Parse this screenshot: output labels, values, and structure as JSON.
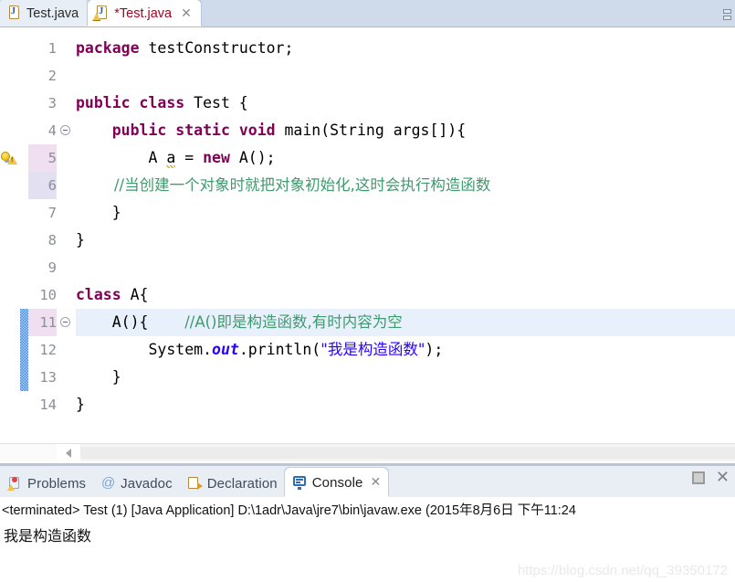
{
  "editor": {
    "tabs": [
      {
        "label": "Test.java",
        "icon": "java-file-icon",
        "active": false,
        "dirty": false
      },
      {
        "label": "*Test.java",
        "icon": "java-file-warning-icon",
        "active": true,
        "dirty": true
      }
    ],
    "close_glyph": "✕",
    "lines": [
      {
        "num": "1",
        "fold": false,
        "marker": null,
        "gutter": "none",
        "current": false,
        "tokens": [
          {
            "t": "package ",
            "c": "kw"
          },
          {
            "t": "testConstructor;",
            "c": "plain"
          }
        ]
      },
      {
        "num": "2",
        "fold": false,
        "marker": null,
        "gutter": "none",
        "current": false,
        "tokens": []
      },
      {
        "num": "3",
        "fold": false,
        "marker": null,
        "gutter": "none",
        "current": false,
        "tokens": [
          {
            "t": "public class ",
            "c": "kw"
          },
          {
            "t": "Test {",
            "c": "plain"
          }
        ]
      },
      {
        "num": "4",
        "fold": true,
        "marker": null,
        "gutter": "none",
        "current": false,
        "tokens": [
          {
            "t": "    ",
            "c": "plain"
          },
          {
            "t": "public static void ",
            "c": "kw"
          },
          {
            "t": "main(String args[]){",
            "c": "plain"
          }
        ]
      },
      {
        "num": "5",
        "fold": false,
        "marker": "warning-bulb-icon",
        "gutter": "pink",
        "current": false,
        "tokens": [
          {
            "t": "        A ",
            "c": "plain"
          },
          {
            "t": "a",
            "c": "warn"
          },
          {
            "t": " = ",
            "c": "plain"
          },
          {
            "t": "new ",
            "c": "kw"
          },
          {
            "t": "A();",
            "c": "plain"
          }
        ]
      },
      {
        "num": "6",
        "fold": false,
        "marker": null,
        "gutter": "lav",
        "current": false,
        "tokens": [
          {
            "t": "        //当创建一个对象时就把对象初始化,这时会执行构造函数",
            "c": "cmt"
          }
        ]
      },
      {
        "num": "7",
        "fold": false,
        "marker": null,
        "gutter": "none",
        "current": false,
        "tokens": [
          {
            "t": "    }",
            "c": "plain"
          }
        ]
      },
      {
        "num": "8",
        "fold": false,
        "marker": null,
        "gutter": "none",
        "current": false,
        "tokens": [
          {
            "t": "}",
            "c": "plain"
          }
        ]
      },
      {
        "num": "9",
        "fold": false,
        "marker": null,
        "gutter": "none",
        "current": false,
        "tokens": []
      },
      {
        "num": "10",
        "fold": false,
        "marker": null,
        "gutter": "none",
        "current": false,
        "tokens": [
          {
            "t": "class ",
            "c": "kw"
          },
          {
            "t": "A{",
            "c": "plain"
          }
        ]
      },
      {
        "num": "11",
        "fold": true,
        "marker": null,
        "gutter": "pink",
        "current": true,
        "changed": true,
        "tokens": [
          {
            "t": "    A(){    ",
            "c": "plain"
          },
          {
            "t": "//A()即是构造函数,有时内容为空",
            "c": "cmt"
          }
        ]
      },
      {
        "num": "12",
        "fold": false,
        "marker": null,
        "gutter": "none",
        "current": false,
        "changed": true,
        "tokens": [
          {
            "t": "        System.",
            "c": "plain"
          },
          {
            "t": "out",
            "c": "fld"
          },
          {
            "t": ".println(",
            "c": "plain"
          },
          {
            "t": "\"我是构造函数\"",
            "c": "str"
          },
          {
            "t": ");",
            "c": "plain"
          }
        ]
      },
      {
        "num": "13",
        "fold": false,
        "marker": null,
        "gutter": "none",
        "current": false,
        "changed": true,
        "tokens": [
          {
            "t": "    }",
            "c": "plain"
          }
        ]
      },
      {
        "num": "14",
        "fold": false,
        "marker": null,
        "gutter": "none",
        "current": false,
        "tokens": [
          {
            "t": "}",
            "c": "plain"
          }
        ]
      }
    ]
  },
  "bottom": {
    "tabs": [
      {
        "label": "Problems",
        "icon": "problems-icon",
        "active": false
      },
      {
        "label": "Javadoc",
        "icon": "javadoc-icon",
        "active": false
      },
      {
        "label": "Declaration",
        "icon": "declaration-icon",
        "active": false
      },
      {
        "label": "Console",
        "icon": "console-icon",
        "active": true
      }
    ],
    "close_glyph": "✕",
    "toolbar": {
      "stop_label": "",
      "close_glyph": "✕"
    },
    "status_line": "<terminated> Test (1) [Java Application] D:\\1adr\\Java\\jre7\\bin\\javaw.exe (2015年8月6日 下午11:24",
    "output": "我是构造函数"
  },
  "watermark": "https://blog.csdn.net/qq_39350172",
  "colors": {
    "keyword": "#7f0055",
    "string": "#2a00ff",
    "comment": "#3f9a6e",
    "field": "#2a00ff",
    "current_line": "#e8f1fb",
    "tab_active_text": "#b00020",
    "change_bar": "#4a90e2"
  }
}
